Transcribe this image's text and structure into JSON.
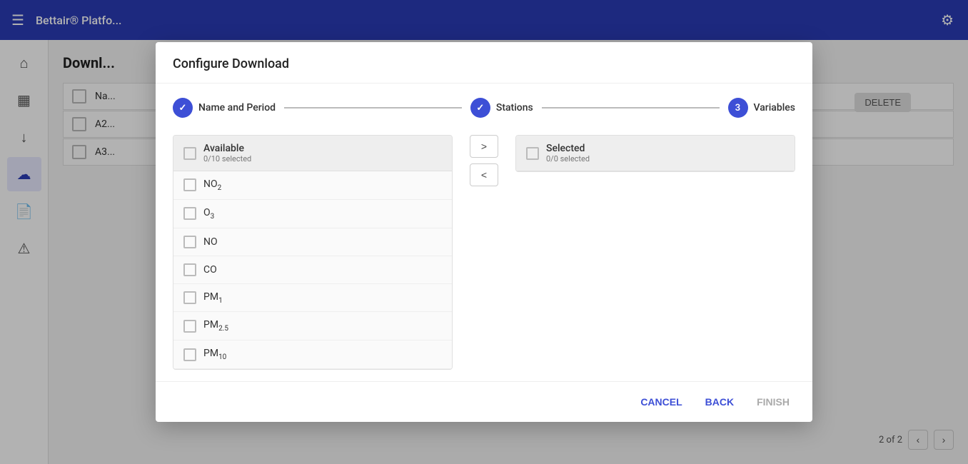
{
  "navbar": {
    "title": "Bettair® Platfo...",
    "menu_icon": "☰",
    "gear_icon": "⚙"
  },
  "sidebar": {
    "items": [
      {
        "icon": "⌂",
        "label": "home",
        "active": false
      },
      {
        "icon": "📊",
        "label": "analytics",
        "active": false
      },
      {
        "icon": "📥",
        "label": "downloads",
        "active": true
      },
      {
        "icon": "☁",
        "label": "upload",
        "active": false
      },
      {
        "icon": "📄",
        "label": "reports",
        "active": false
      },
      {
        "icon": "⚠",
        "label": "alerts",
        "active": false
      }
    ]
  },
  "main": {
    "title": "Downl...",
    "delete_button": "DELETE",
    "rows": [
      {
        "id": "A2..."
      },
      {
        "id": "A3..."
      }
    ],
    "pagination": {
      "text": "2 of 2",
      "prev": "<",
      "next": ">"
    }
  },
  "modal": {
    "title": "Configure Download",
    "stepper": {
      "steps": [
        {
          "label": "Name and Period",
          "state": "completed",
          "number": "✓"
        },
        {
          "label": "Stations",
          "state": "completed",
          "number": "✓"
        },
        {
          "label": "Variables",
          "state": "active",
          "number": "3"
        }
      ]
    },
    "available_panel": {
      "title": "Available",
      "subtitle": "0/10 selected",
      "items": [
        {
          "label": "NO",
          "sub": "2",
          "id": "no2"
        },
        {
          "label": "O",
          "sub": "3",
          "id": "o3"
        },
        {
          "label": "NO",
          "sub": "",
          "id": "no"
        },
        {
          "label": "CO",
          "sub": "",
          "id": "co"
        },
        {
          "label": "PM",
          "sub": "1",
          "id": "pm1"
        },
        {
          "label": "PM",
          "sub": "2.5",
          "id": "pm25"
        },
        {
          "label": "PM",
          "sub": "10",
          "id": "pm10"
        }
      ]
    },
    "selected_panel": {
      "title": "Selected",
      "subtitle": "0/0 selected",
      "items": []
    },
    "transfer_right": ">",
    "transfer_left": "<",
    "footer": {
      "cancel": "CANCEL",
      "back": "BACK",
      "finish": "FINISH"
    }
  }
}
